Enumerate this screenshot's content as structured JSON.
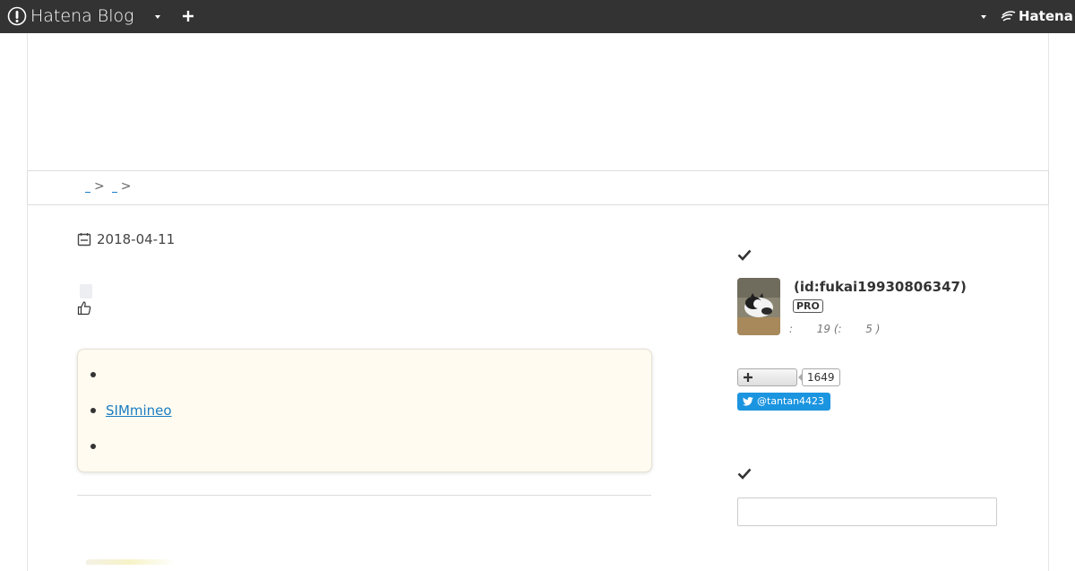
{
  "toolbar": {
    "brand_label": "Hatena Blog",
    "right_brand_label": "Hatena"
  },
  "breadcrumb": {
    "separator": ">"
  },
  "entry": {
    "date": "2018-04-11"
  },
  "toc": {
    "items": [
      {
        "label": ""
      },
      {
        "label": "SIMmineo"
      },
      {
        "label": ""
      }
    ]
  },
  "sidebar": {
    "profile": {
      "user_id": "(id:fukai19930806347)",
      "badge": "PRO",
      "stats": ":       19 (:       5 )"
    },
    "subscribe": {
      "count": "1649"
    },
    "twitter": {
      "handle": "@tantan4423"
    },
    "search": {
      "value": ""
    }
  },
  "colors": {
    "toolbar_bg": "#333333",
    "link": "#1a7dc3",
    "toc_bg": "#fffbf0",
    "twitter": "#1b95e0"
  },
  "icons": {
    "brand": "hatena-blog-logo-icon",
    "dropdown": "caret-down-icon",
    "add": "plus-icon",
    "date": "calendar-icon",
    "like": "thumbs-up-icon",
    "section": "check-icon",
    "twitter": "twitter-bird-icon"
  }
}
